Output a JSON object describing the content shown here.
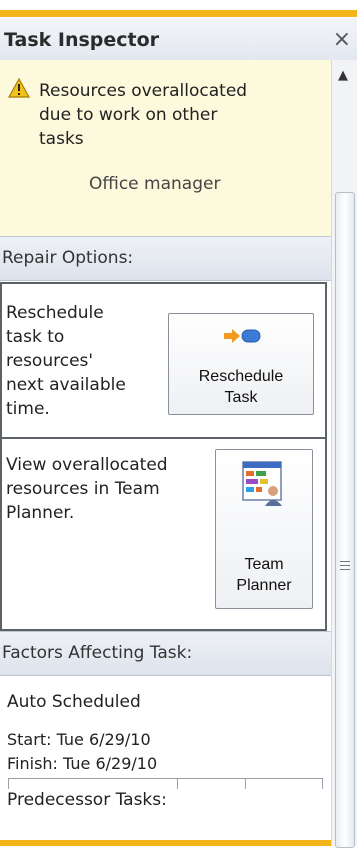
{
  "pane": {
    "title": "Task Inspector",
    "close_icon": "×"
  },
  "warning": {
    "icon": "warning-icon",
    "message_lines": [
      "Resources overallocated",
      "due to work on other",
      "tasks"
    ],
    "resource": "Office manager"
  },
  "repair": {
    "header": "Repair Options:",
    "option1": {
      "text_lines": [
        "Reschedule",
        "task to",
        "resources'",
        "next available",
        "time."
      ],
      "button_lines": [
        "Reschedule",
        "Task"
      ],
      "button_icon": "reschedule-arrow-icon"
    },
    "option2": {
      "text_lines": [
        "View overallocated",
        "resources in Team",
        "Planner."
      ],
      "button_lines": [
        "Team",
        "Planner"
      ],
      "button_icon": "team-planner-icon"
    }
  },
  "factors": {
    "header": "Factors Affecting Task:",
    "mode": "Auto Scheduled",
    "start": "Start: Tue 6/29/10",
    "finish": "Finish: Tue 6/29/10",
    "predecessor_label": "Predecessor Tasks:"
  },
  "colors": {
    "accent": "#f3b51a",
    "warning_bg": "#fcf9dc"
  }
}
